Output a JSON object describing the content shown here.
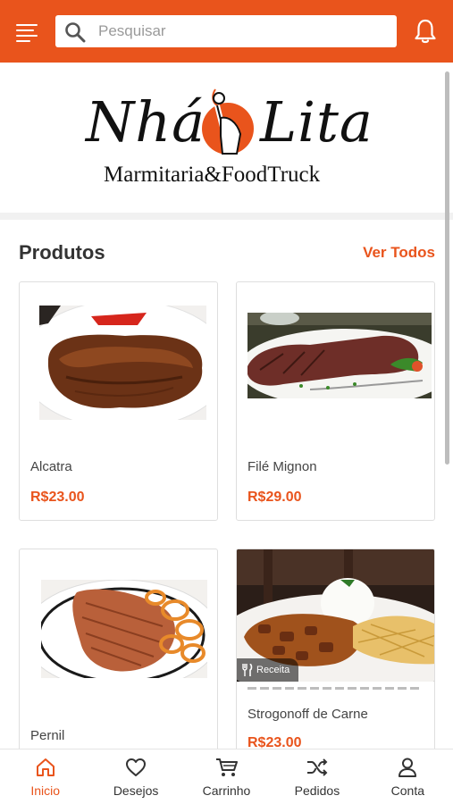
{
  "header": {
    "search_placeholder": "Pesquisar",
    "accent_color": "#e9541c"
  },
  "logo": {
    "left_text": "Nhá",
    "right_text": "Lita",
    "subtitle": "Marmitaria&FoodTruck"
  },
  "section": {
    "title": "Produtos",
    "see_all_label": "Ver Todos"
  },
  "products": [
    {
      "name": "Alcatra",
      "price": "R$23.00"
    },
    {
      "name": "Filé Mignon",
      "price": "R$29.00"
    },
    {
      "name": "Pernil",
      "price": ""
    },
    {
      "name": "Strogonoff de Carne",
      "price": "R$23.00",
      "badge": "Receita"
    }
  ],
  "bottom_nav": [
    {
      "label": "Inicio",
      "icon": "home-icon",
      "active": true
    },
    {
      "label": "Desejos",
      "icon": "heart-icon",
      "active": false
    },
    {
      "label": "Carrinho",
      "icon": "cart-icon",
      "active": false
    },
    {
      "label": "Pedidos",
      "icon": "shuffle-icon",
      "active": false
    },
    {
      "label": "Conta",
      "icon": "user-icon",
      "active": false
    }
  ]
}
